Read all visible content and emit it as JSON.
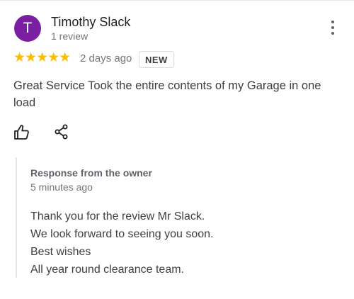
{
  "review": {
    "avatar_initial": "T",
    "avatar_color": "#7b1fa2",
    "reviewer_name": "Timothy Slack",
    "review_count": "1 review",
    "rating_stars": "★★★★★",
    "rating": 5,
    "date": "2 days ago",
    "badge": "NEW",
    "text": "Great Service Took the entire contents of my Garage in one load",
    "actions": {
      "like_icon": "thumbs-up-icon",
      "share_icon": "share-icon",
      "more_icon": "more-vert-icon"
    }
  },
  "owner_response": {
    "title": "Response from the owner",
    "time": "5 minutes ago",
    "lines": [
      "Thank you for the review Mr Slack.",
      "We look forward to seeing you soon.",
      "Best wishes",
      "All year round clearance team."
    ]
  },
  "colors": {
    "star": "#fbbc04",
    "secondary_text": "#70757a"
  }
}
